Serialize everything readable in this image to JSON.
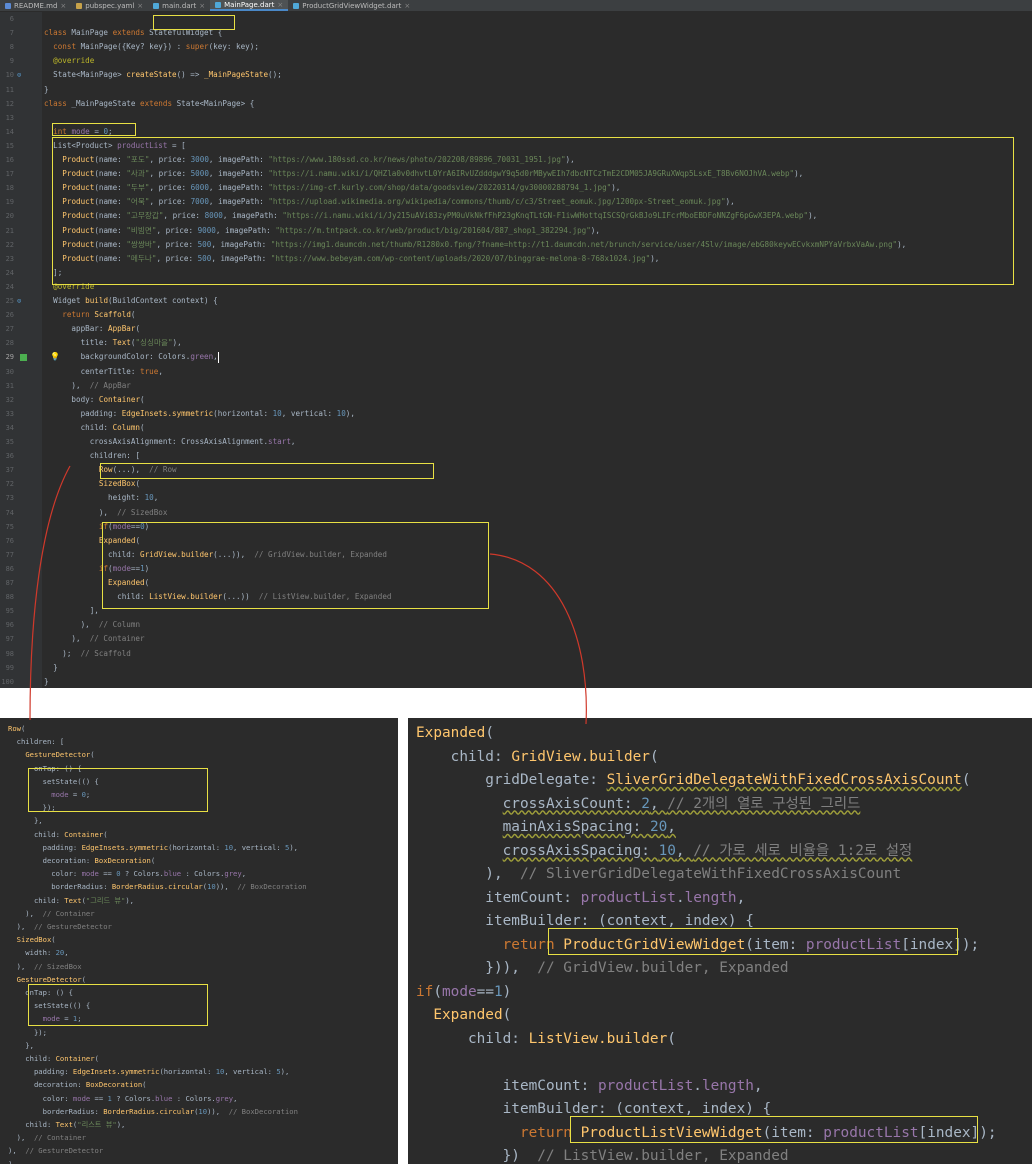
{
  "tabs": [
    {
      "label": "README.md",
      "color": "#5b8bd6",
      "active": false
    },
    {
      "label": "pubspec.yaml",
      "color": "#c7a24a",
      "active": false
    },
    {
      "label": "main.dart",
      "color": "#4fa8d8",
      "active": false
    },
    {
      "label": "MainPage.dart",
      "color": "#4fa8d8",
      "active": true
    },
    {
      "label": "ProductGridViewWidget.dart",
      "color": "#4fa8d8",
      "active": false
    }
  ],
  "editor": {
    "lines": [
      {
        "n": "6",
        "html": ""
      },
      {
        "n": "7",
        "html": "<span class=\"k\">class</span> MainPage <span class=\"k\">extends</span> StatefulWidget {"
      },
      {
        "n": "8",
        "html": "  <span class=\"k\">const</span> MainPage({Key? key}) : <span class=\"k\">super</span>(key: key);"
      },
      {
        "n": "9",
        "html": "  <span class=\"a\">@override</span>"
      },
      {
        "n": "10",
        "html": "  State&lt;MainPage&gt; <span class=\"f\">createState</span>() =&gt; <span class=\"f\">_MainPageState</span>();"
      },
      {
        "n": "11",
        "html": "}"
      },
      {
        "n": "12",
        "html": "<span class=\"k\">class</span> _MainPageState <span class=\"k\">extends</span> State&lt;MainPage&gt; {"
      },
      {
        "n": "13",
        "html": ""
      },
      {
        "n": "14",
        "html": "  <span class=\"k\">int</span> <span class=\"p\">mode</span> = <span class=\"n\">0</span>;"
      },
      {
        "n": "15",
        "html": "  List&lt;Product&gt; <span class=\"p\">productList</span> = ["
      },
      {
        "n": "16",
        "html": "    <span class=\"f\">Product</span>(name: <span class=\"s\">\"포도\"</span>, price: <span class=\"n\">3000</span>, imagePath: <span class=\"s\">\"https://www.180ssd.co.kr/news/photo/202208/89896_70031_1951.jpg\"</span>),"
      },
      {
        "n": "17",
        "html": "    <span class=\"f\">Product</span>(name: <span class=\"s\">\"사과\"</span>, price: <span class=\"n\">5000</span>, imagePath: <span class=\"s\">\"https://i.namu.wiki/i/QHZla0v0dhvtL0YrA6IRvUZdddgwY9q5d0rMBywEIh7dbcNTCzTmE2CDM05JA9GRuXWqp5LsxE_T8Bv6NOJhVA.webp\"</span>),"
      },
      {
        "n": "18",
        "html": "    <span class=\"f\">Product</span>(name: <span class=\"s\">\"두부\"</span>, price: <span class=\"n\">6000</span>, imagePath: <span class=\"s\">\"https://img-cf.kurly.com/shop/data/goodsview/20220314/gv30000288794_1.jpg\"</span>),"
      },
      {
        "n": "19",
        "html": "    <span class=\"f\">Product</span>(name: <span class=\"s\">\"어묵\"</span>, price: <span class=\"n\">7000</span>, imagePath: <span class=\"s\">\"https://upload.wikimedia.org/wikipedia/commons/thumb/c/c3/Street_eomuk.jpg/1200px-Street_eomuk.jpg\"</span>),"
      },
      {
        "n": "20",
        "html": "    <span class=\"f\">Product</span>(name: <span class=\"s\">\"고무장갑\"</span>, price: <span class=\"n\">8000</span>, imagePath: <span class=\"s\">\"https://i.namu.wiki/i/Jy215uAVi83zyPM0uVkNkfFhP23gKnqTLtGN-F1iwWHottqISCSQrGkBJo9LIFcrMboEBDFoNNZgF6pGwX3EPA.webp\"</span>),"
      },
      {
        "n": "21",
        "html": "    <span class=\"f\">Product</span>(name: <span class=\"s\">\"비빔면\"</span>, price: <span class=\"n\">9000</span>, imagePath: <span class=\"s\">\"https://m.tntpack.co.kr/web/product/big/201604/887_shop1_382294.jpg\"</span>),"
      },
      {
        "n": "22",
        "html": "    <span class=\"f\">Product</span>(name: <span class=\"s\">\"쌍쌍바\"</span>, price: <span class=\"n\">500</span>, imagePath: <span class=\"s\">\"https://img1.daumcdn.net/thumb/R1280x0.fpng/?fname=http://t1.daumcdn.net/brunch/service/user/4Slv/image/ebG80keywECvkxmNPYaVrbxVaAw.png\"</span>),"
      },
      {
        "n": "23",
        "html": "    <span class=\"f\">Product</span>(name: <span class=\"s\">\"메두나\"</span>, price: <span class=\"n\">500</span>, imagePath: <span class=\"s\">\"https://www.bebeyam.com/wp-content/uploads/2020/07/binggrae-melona-8-768x1024.jpg\"</span>),"
      },
      {
        "n": "24",
        "html": "  ];"
      },
      {
        "n": "24",
        "html": "  <span class=\"a\">@override</span>"
      },
      {
        "n": "25",
        "html": "  Widget <span class=\"f\">build</span>(BuildContext context) {"
      },
      {
        "n": "26",
        "html": "    <span class=\"k\">return</span> <span class=\"f\">Scaffold</span>("
      },
      {
        "n": "27",
        "html": "      appBar: <span class=\"f\">AppBar</span>("
      },
      {
        "n": "28",
        "html": "        title: <span class=\"f\">Text</span>(<span class=\"s\">\"싱싱마을\"</span>),"
      },
      {
        "n": "29",
        "html": "        backgroundColor: Colors.<span class=\"p\">green</span>,<span class=\"cursor\"></span>"
      },
      {
        "n": "30",
        "html": "        centerTitle: <span class=\"k\">true</span>,"
      },
      {
        "n": "31",
        "html": "      ),  <span class=\"c\">// AppBar</span>"
      },
      {
        "n": "32",
        "html": "      body: <span class=\"f\">Container</span>("
      },
      {
        "n": "33",
        "html": "        padding: <span class=\"f\">EdgeInsets.symmetric</span>(horizontal: <span class=\"n\">10</span>, vertical: <span class=\"n\">10</span>),"
      },
      {
        "n": "34",
        "html": "        child: <span class=\"f\">Column</span>("
      },
      {
        "n": "35",
        "html": "          crossAxisAlignment: CrossAxisAlignment.<span class=\"p\">start</span>,"
      },
      {
        "n": "36",
        "html": "          children: ["
      },
      {
        "n": "37",
        "html": "            <span class=\"f\">Row</span>(...),  <span class=\"c\">// Row</span>"
      },
      {
        "n": "72",
        "html": "            <span class=\"f\">SizedBox</span>("
      },
      {
        "n": "73",
        "html": "              height: <span class=\"n\">10</span>,"
      },
      {
        "n": "74",
        "html": "            ),  <span class=\"c\">// SizedBox</span>"
      },
      {
        "n": "75",
        "html": "            <span class=\"k\">if</span>(<span class=\"p\">mode</span>==<span class=\"n\">0</span>)"
      },
      {
        "n": "76",
        "html": "            <span class=\"f\">Expanded</span>("
      },
      {
        "n": "77",
        "html": "              child: <span class=\"f\">GridView.builder</span>(...)),  <span class=\"c\">// GridView.builder, Expanded</span>"
      },
      {
        "n": "86",
        "html": "            <span class=\"k\">if</span>(<span class=\"p\">mode</span>==<span class=\"n\">1</span>)"
      },
      {
        "n": "87",
        "html": "              <span class=\"f\">Expanded</span>("
      },
      {
        "n": "88",
        "html": "                child: <span class=\"f\">ListView.builder</span>(...))  <span class=\"c\">// ListView.builder, Expanded</span>"
      },
      {
        "n": "95",
        "html": "          ],"
      },
      {
        "n": "96",
        "html": "        ),  <span class=\"c\">// Column</span>"
      },
      {
        "n": "97",
        "html": "      ),  <span class=\"c\">// Container</span>"
      },
      {
        "n": "98",
        "html": "    );  <span class=\"c\">// Scaffold</span>"
      },
      {
        "n": "99",
        "html": "  }"
      },
      {
        "n": "100",
        "html": "}"
      }
    ]
  },
  "row_snippet": {
    "lines": [
      "<span class=\"f\">Row</span>(",
      "  children: [",
      "    <span class=\"f\">GestureDetector</span>(",
      "      onTap: () {",
      "        setState(() {",
      "          <span class=\"p\">mode</span> = <span class=\"n\">0</span>;",
      "        });",
      "      },",
      "      child: <span class=\"f\">Container</span>(",
      "        padding: <span class=\"f\">EdgeInsets.symmetric</span>(horizontal: <span class=\"n\">10</span>, vertical: <span class=\"n\">5</span>),",
      "        decoration: <span class=\"f\">BoxDecoration</span>(",
      "          color: <span class=\"p\">mode</span> == <span class=\"n\">0</span> ? Colors.<span class=\"p\">blue</span> : Colors.<span class=\"p\">grey</span>,",
      "          borderRadius: <span class=\"f\">BorderRadius.circular</span>(<span class=\"n\">10</span>)),  <span class=\"c\">// BoxDecoration</span>",
      "      child: <span class=\"f\">Text</span>(<span class=\"s\">\"그리드 뷰\"</span>),",
      "    ),  <span class=\"c\">// Container</span>",
      "  ),  <span class=\"c\">// GestureDetector</span>",
      "  <span class=\"f\">SizedBox</span>(",
      "    width: <span class=\"n\">20</span>,",
      "  ),  <span class=\"c\">// SizedBox</span>",
      "  <span class=\"f\">GestureDetector</span>(",
      "    onTap: () {",
      "      setState(() {",
      "        <span class=\"p\">mode</span> = <span class=\"n\">1</span>;",
      "      });",
      "    },",
      "    child: <span class=\"f\">Container</span>(",
      "      padding: <span class=\"f\">EdgeInsets.symmetric</span>(horizontal: <span class=\"n\">10</span>, vertical: <span class=\"n\">5</span>),",
      "      decoration: <span class=\"f\">BoxDecoration</span>(",
      "        color: <span class=\"p\">mode</span> == <span class=\"n\">1</span> ? Colors.<span class=\"p\">blue</span> : Colors.<span class=\"p\">grey</span>,",
      "        borderRadius: <span class=\"f\">BorderRadius.circular</span>(<span class=\"n\">10</span>)),  <span class=\"c\">// BoxDecoration</span>",
      "    child: <span class=\"f\">Text</span>(<span class=\"s\">\"리스트 뷰\"</span>),",
      "  ),  <span class=\"c\">// Container</span>",
      "),  <span class=\"c\">// GestureDetector</span>",
      "],",
      "),  <span class=\"c\">// Row</span>"
    ]
  },
  "expanded_snippet": {
    "lines": [
      "<span class=\"f\">Expanded</span>(",
      "    child: <span class=\"f\">GridView.builder</span>(",
      "        gridDelegate: <span class=\"f wavy\">SliverGridDelegateWithFixedCrossAxisCount</span>(",
      "          <span class=\"wavy\">crossAxisCount: <span class=\"n\">2</span>, <span class=\"c\">// 2개의 열로 구성된 그리드</span></span>",
      "          <span class=\"wavy\">mainAxisSpacing: <span class=\"n\">20</span>,</span>",
      "          <span class=\"wavy\">crossAxisSpacing: <span class=\"n\">10</span>, <span class=\"c\">// 가로 세로 비율을 1:2로 설정</span></span>",
      "        ),  <span class=\"c\">// SliverGridDelegateWithFixedCrossAxisCount</span>",
      "        itemCount: <span class=\"p\">productList</span>.<span class=\"p\">length</span>,",
      "        itemBuilder: (context, index) {",
      "          <span class=\"k\">return</span> <span class=\"f\">ProductGridViewWidget</span>(item: <span class=\"p\">productList</span>[index]);",
      "        })),  <span class=\"c\">// GridView.builder, Expanded</span>",
      "<span class=\"k\">if</span>(<span class=\"p\">mode</span>==<span class=\"n\">1</span>)",
      "  <span class=\"f\">Expanded</span>(",
      "      child: <span class=\"f\">ListView.builder</span>(",
      "",
      "          itemCount: <span class=\"p\">productList</span>.<span class=\"p\">length</span>,",
      "          itemBuilder: (context, index) {",
      "            <span class=\"k\">return</span> <span class=\"f\">ProductListViewWidget</span>(item: <span class=\"p\">productList</span>[index]);",
      "          })  <span class=\"c\">// ListView.builder, Expanded</span>"
    ]
  },
  "colors": {
    "highlight": "#e8e044",
    "connector": "#d0392b",
    "editor_bg": "#2b2b2b"
  }
}
